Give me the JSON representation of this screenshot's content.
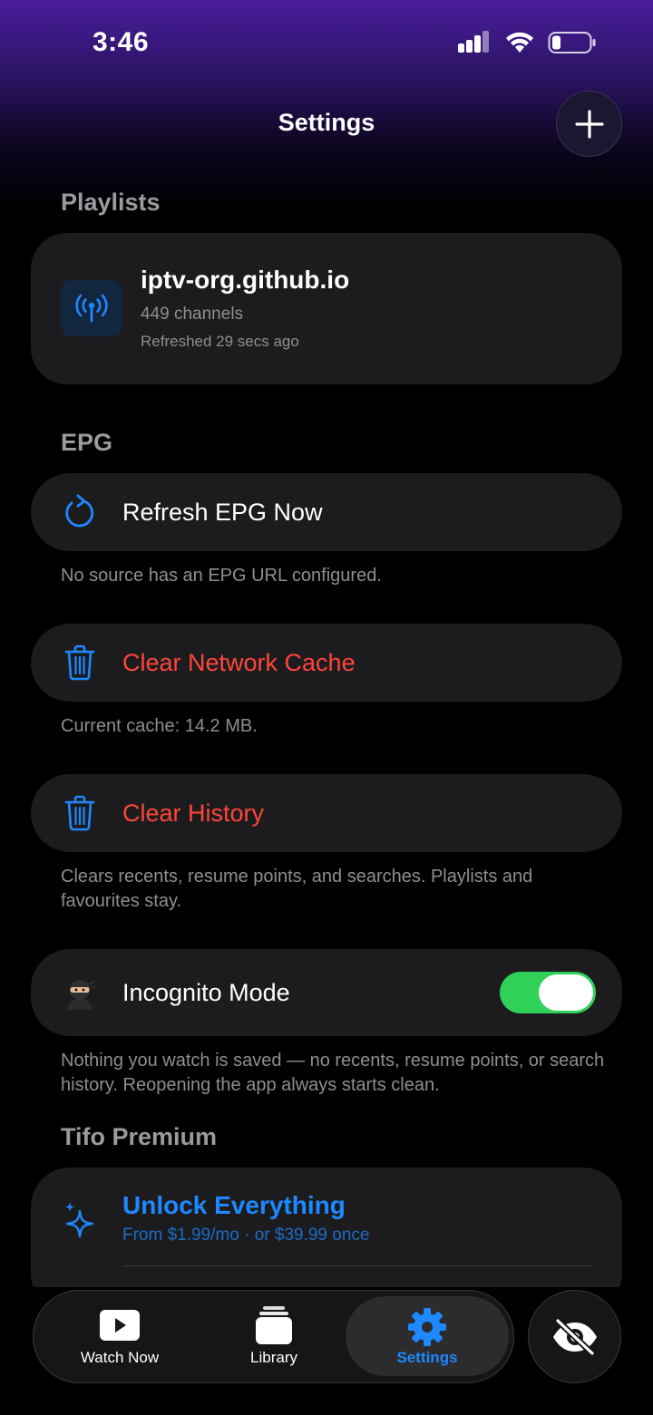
{
  "status_bar": {
    "time": "3:46"
  },
  "header": {
    "title": "Settings",
    "add_icon": "plus-icon"
  },
  "playlists": {
    "section_label": "Playlists",
    "items": [
      {
        "title": "iptv-org.github.io",
        "channels": "449 channels",
        "refreshed": "Refreshed 29 secs ago",
        "icon": "antenna-icon"
      }
    ]
  },
  "epg": {
    "section_label": "EPG",
    "refresh_label": "Refresh EPG Now",
    "refresh_note": "No source has an EPG URL configured.",
    "clear_cache_label": "Clear Network Cache",
    "cache_note": "Current cache: 14.2 MB.",
    "clear_history_label": "Clear History",
    "history_note": "Clears recents, resume points, and searches. Playlists and favourites stay.",
    "incognito_label": "Incognito Mode",
    "incognito_enabled": true,
    "incognito_note": "Nothing you watch is saved — no recents, resume points, or search history. Reopening the app always starts clean."
  },
  "premium": {
    "section_label": "Tifo Premium",
    "title": "Unlock Everything",
    "subtitle": "From $1.99/mo · or $39.99 once"
  },
  "tabbar": {
    "tabs": [
      {
        "label": "Watch Now",
        "icon": "play-icon"
      },
      {
        "label": "Library",
        "icon": "library-icon"
      },
      {
        "label": "Settings",
        "icon": "gear-icon",
        "active": true
      }
    ],
    "side_button_icon": "eye-slash-icon"
  },
  "colors": {
    "accent_blue": "#1e88ff",
    "destructive_red": "#ff453a",
    "toggle_green": "#30d158",
    "card_bg": "#1c1c1e"
  }
}
